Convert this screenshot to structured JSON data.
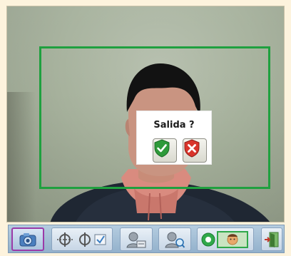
{
  "dialog": {
    "title": "Salida ?",
    "yes_icon": "check-shield-icon",
    "no_icon": "x-shield-icon"
  },
  "detection": {
    "box_color": "#1fa03f"
  },
  "toolbar": {
    "items": [
      {
        "icon": "camera-capture-icon",
        "active": true
      },
      {
        "icon": "compare-faces-icon"
      },
      {
        "icon": "face-database-icon"
      },
      {
        "icon": "face-search-icon"
      },
      {
        "icon": "live-recognition-icon"
      },
      {
        "icon": "exit-door-icon"
      }
    ]
  },
  "colors": {
    "background": "#fdf3dd",
    "toolbar": "#a6c0d8",
    "active_border": "#9b3aa8",
    "confirm_green": "#2e9a3a",
    "cancel_red": "#d9342b"
  }
}
